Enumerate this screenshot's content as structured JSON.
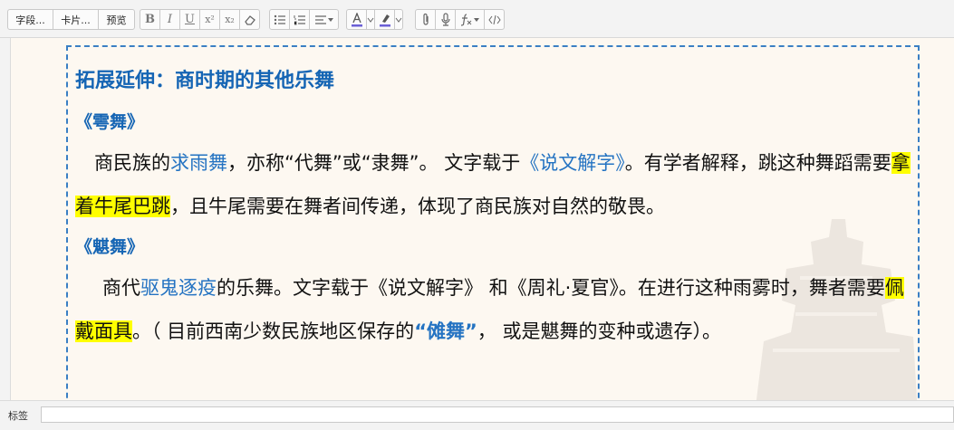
{
  "toolbar": {
    "field_button": "字段...",
    "card_button": "卡片...",
    "preview_button": "预览",
    "bold": "B",
    "italic": "I",
    "underline": "U",
    "superscript": "x²",
    "subscript": "x₂"
  },
  "colors": {
    "heading": "#1565b4",
    "link": "#2473c2",
    "highlight": "#ffff00",
    "border": "#3a7fc4",
    "background": "#fdf8f1"
  },
  "card": {
    "title": "拓展延伸：商时期的其他乐舞",
    "sections": [
      {
        "heading": "《雩舞》",
        "p1": "商民族的",
        "link": "求雨舞",
        "p2": "，亦称“代舞”或“隶舞”。 文字载于",
        "link2": "《说文解字》",
        "p3": "。有学者解释，跳这种舞蹈需要",
        "highlight": "拿着牛尾巴跳",
        "p4": "，且牛尾需要在舞者间传递，体现了商民族对自然的敬畏。"
      },
      {
        "heading": "《魌舞》",
        "p1": "商代",
        "link": "驱鬼逐疫",
        "p2": "的乐舞。文字载于《说文解字》 和《周礼·夏官》。在进行这种雨雾时，舞者需要",
        "highlight": "佩戴面具",
        "p3": "。（ 目前西南少数民族地区保存的",
        "bold": "“傩舞”",
        "p4": "， 或是魌舞的变种或遗存）。"
      }
    ]
  },
  "footer": {
    "tag_label": "标签",
    "tag_value": ""
  }
}
